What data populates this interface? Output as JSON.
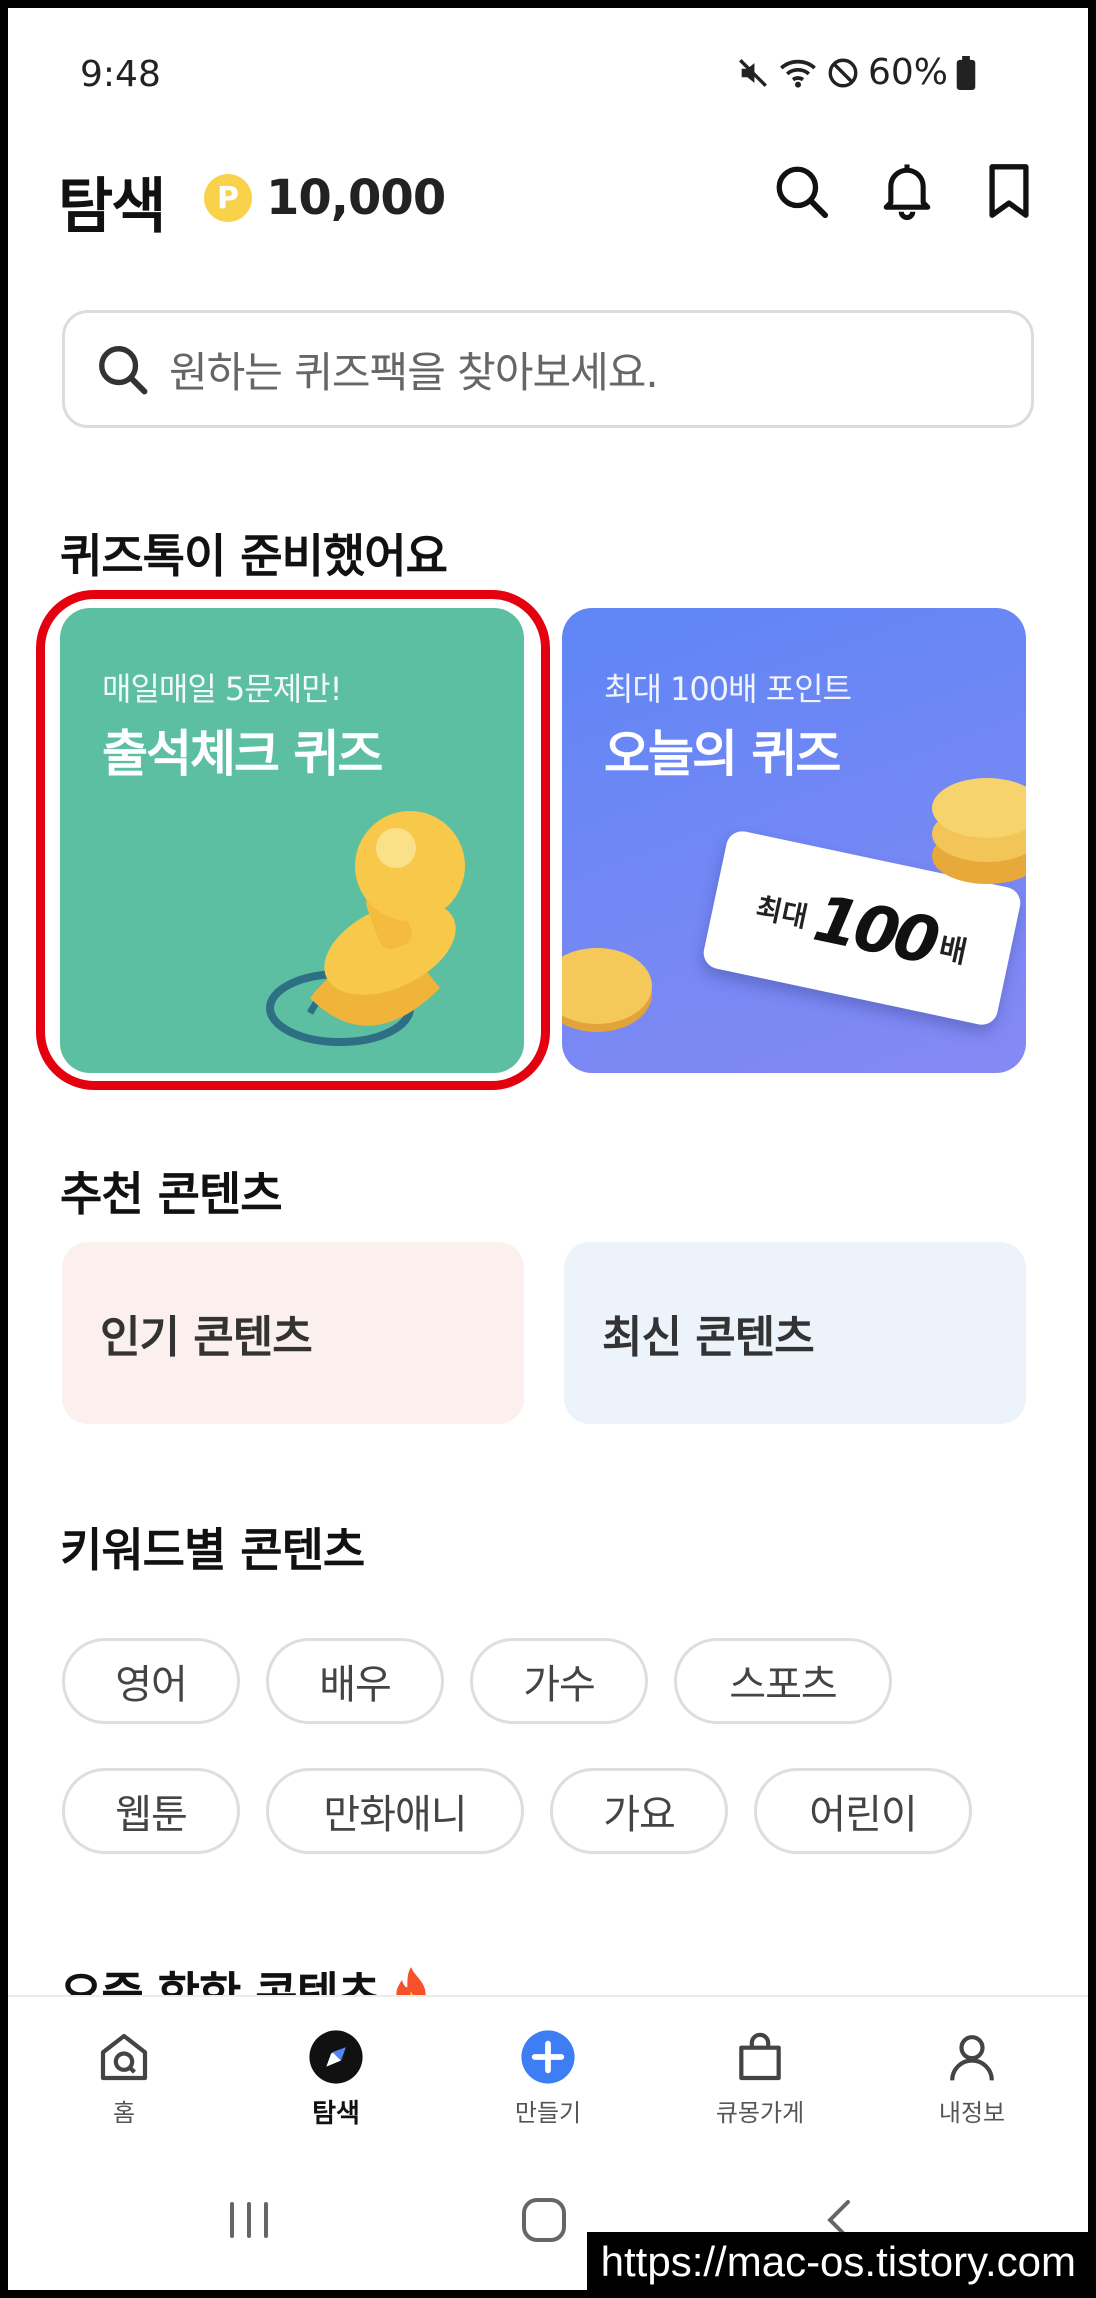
{
  "status_bar": {
    "time": "9:48",
    "battery": "60%"
  },
  "header": {
    "title": "탐색",
    "points_symbol": "P",
    "points": "10,000"
  },
  "search": {
    "placeholder": "원하는 퀴즈팩을 찾아보세요."
  },
  "quiz_section": {
    "title": "퀴즈톡이 준비했어요",
    "cards": [
      {
        "subtitle": "매일매일 5문제만!",
        "title": "출석체크 퀴즈",
        "color": "#5cbfa2"
      },
      {
        "subtitle": "최대 100배 포인트",
        "title": "오늘의 퀴즈",
        "color": "#6b8bf3",
        "ticket_label": "최대",
        "ticket_value": "100",
        "ticket_unit": "배"
      }
    ]
  },
  "recommended": {
    "title": "추천 콘텐츠",
    "items": [
      {
        "label": "인기 콘텐츠",
        "color": "#fbf0ee"
      },
      {
        "label": "최신 콘텐츠",
        "color": "#edf3fb"
      }
    ]
  },
  "keywords": {
    "title": "키워드별 콘텐츠",
    "chips": [
      "영어",
      "배우",
      "가수",
      "스포츠",
      "웹툰",
      "만화애니",
      "가요",
      "어린이"
    ]
  },
  "trending": {
    "title": "요즘 핫한 콘텐츠"
  },
  "bottom_nav": [
    {
      "label": "홈",
      "icon": "home-q-icon"
    },
    {
      "label": "탐색",
      "icon": "compass-icon",
      "active": true
    },
    {
      "label": "만들기",
      "icon": "plus-icon"
    },
    {
      "label": "큐몽가게",
      "icon": "shopping-bag-icon"
    },
    {
      "label": "내정보",
      "icon": "person-icon"
    }
  ],
  "watermark": "https://mac-os.tistory.com",
  "accent_color": "#3d7ef5",
  "highlight_color": "#e50010"
}
